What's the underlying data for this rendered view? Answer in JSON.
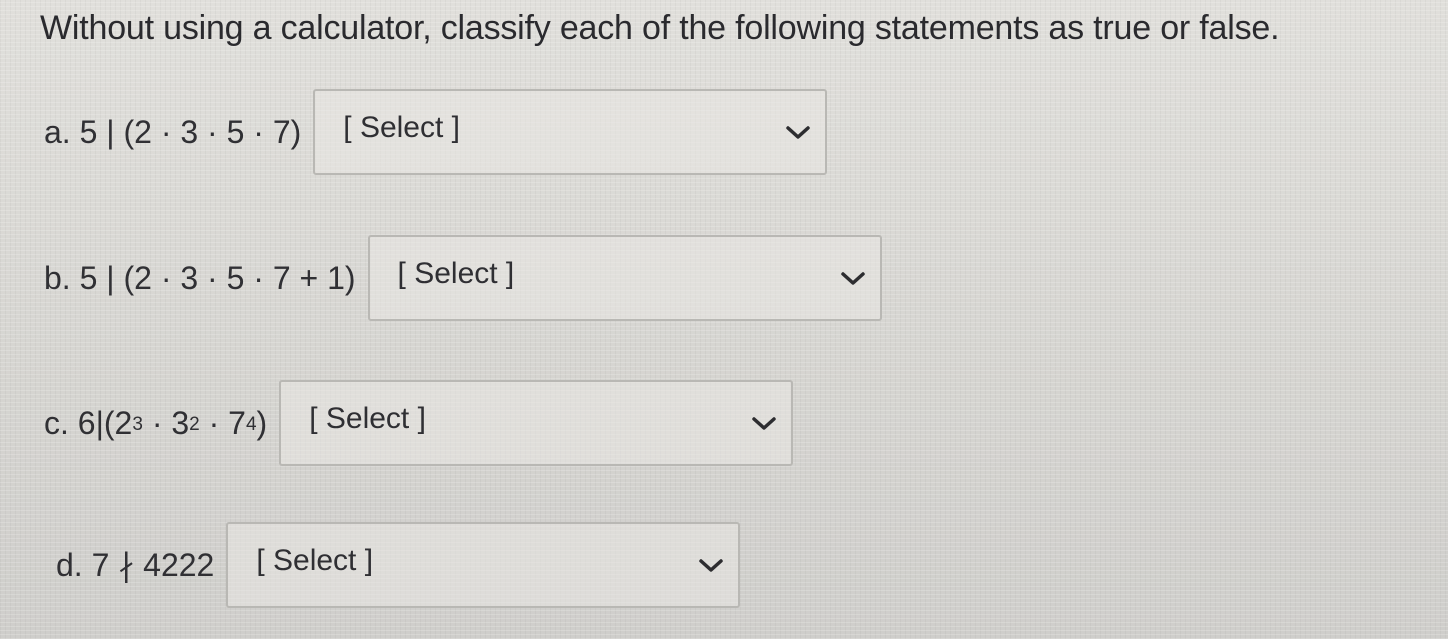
{
  "prompt": "Without using a calculator, classify each of the following statements as true or false.",
  "select_placeholder": "[ Select ]",
  "items": [
    {
      "label": "a.",
      "expression": "5 | (2 · 3 · 5 · 7)"
    },
    {
      "label": "b.",
      "expression": "5 | (2 · 3 · 5 · 7 + 1)"
    },
    {
      "label": "c.",
      "expression_prefix": "6|(2",
      "exp1": "3",
      "mid1": " · 3",
      "exp2": "2",
      "mid2": " · 7",
      "exp3": "4",
      "suffix": ")"
    },
    {
      "label": "d.",
      "expression": "7 ∤ 4222"
    }
  ],
  "icons": {
    "dropdown": "chevron-down-icon"
  }
}
